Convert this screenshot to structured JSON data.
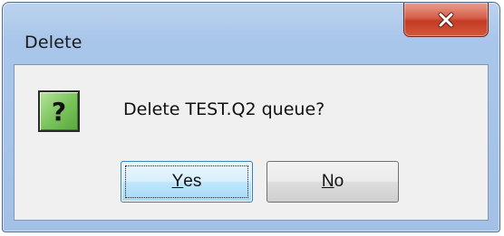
{
  "window": {
    "title": "Delete"
  },
  "message": {
    "text": "Delete TEST.Q2 queue?",
    "icon": "question-icon"
  },
  "buttons": {
    "yes_mnemonic": "Y",
    "yes_rest": "es",
    "no_mnemonic": "N",
    "no_rest": "o"
  },
  "colors": {
    "close_button": "#c43b23",
    "icon_green": "#78c25a",
    "frame": "#a9c6ea"
  }
}
